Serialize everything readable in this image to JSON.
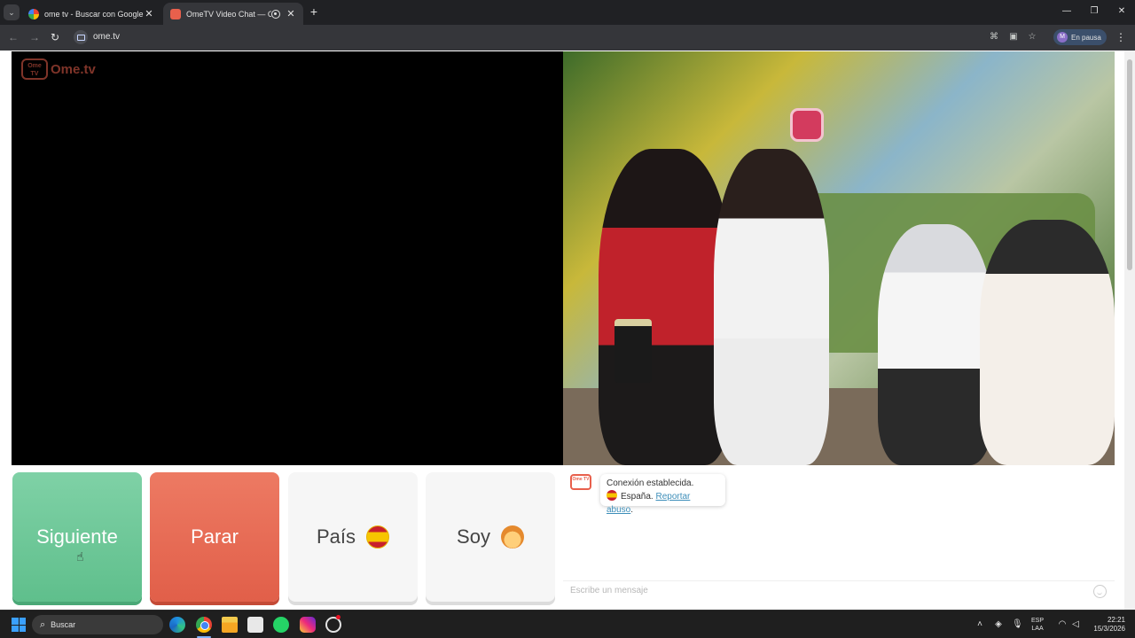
{
  "browser": {
    "tabs": [
      {
        "title": "ome tv - Buscar con Google",
        "active": false
      },
      {
        "title": "OmeTV Video Chat — Ome",
        "active": true
      }
    ],
    "new_tab_label": "+",
    "url": "ome.tv",
    "profile_status": "En pausa",
    "profile_initial": "M"
  },
  "page": {
    "brand": {
      "logo_text": "Ome TV",
      "name": "Ome.tv"
    },
    "buttons": {
      "next": "Siguiente",
      "stop": "Parar",
      "country": "País",
      "soy": "Soy"
    },
    "chat": {
      "logo_text": "Ome TV",
      "status_line": "Conexión establecida.",
      "country": "España.",
      "report_link": "Reportar abuso",
      "report_suffix": ".",
      "input_placeholder": "Escribe un mensaje"
    }
  },
  "taskbar": {
    "search_label": "Buscar",
    "language_line1": "ESP",
    "language_line2": "LAA",
    "time": "22:21",
    "date": "15/3/2026"
  },
  "colors": {
    "next_button": "#6fc99a",
    "stop_button": "#e8684f",
    "neutral_button": "#f6f6f6",
    "brand": "#e8604c",
    "link": "#3d8eb9"
  }
}
